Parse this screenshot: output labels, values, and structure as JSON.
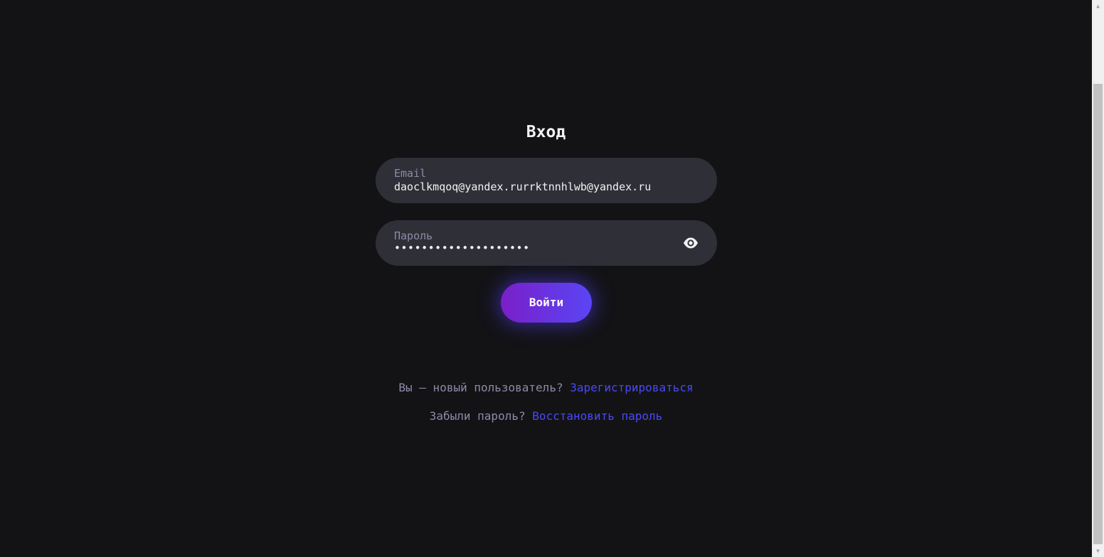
{
  "page": {
    "title": "Вход"
  },
  "email_field": {
    "label": "Email",
    "value": "daoclkmqoq@yandex.rurrktnnhlwb@yandex.ru"
  },
  "password_field": {
    "label": "Пароль",
    "masked_value": "••••••••••••••••••••",
    "toggle_icon": "eye-icon"
  },
  "login_button": {
    "label": "Войти"
  },
  "register_prompt": {
    "text": "Вы — новый пользователь?",
    "link": "Зарегистрироваться"
  },
  "forgot_prompt": {
    "text": "Забыли пароль?",
    "link": "Восстановить пароль"
  },
  "colors": {
    "background": "#131316",
    "field_bg": "#2f2f37",
    "label": "#8e8aa6",
    "link": "#4c48f3",
    "button_gradient_start": "#7a1fc8",
    "button_gradient_end": "#5a45f5"
  }
}
